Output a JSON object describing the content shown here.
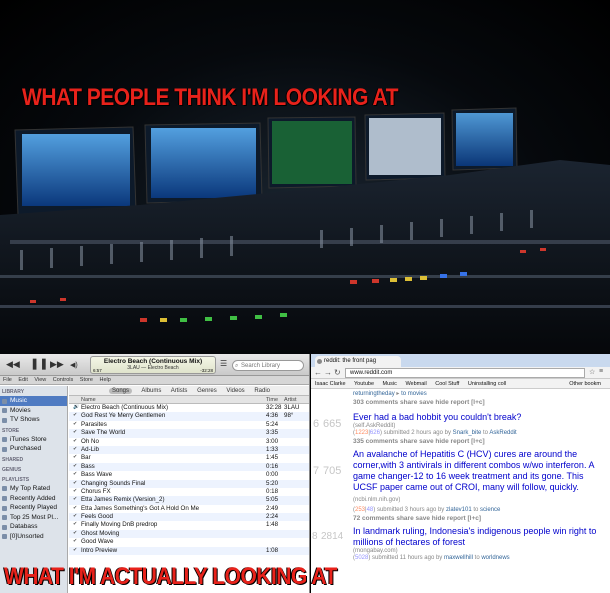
{
  "captions": {
    "top": "WHAT PEOPLE THINK I'M LOOKING AT",
    "bottom": "WHAT I'M ACTUALLY LOOKING AT"
  },
  "itunes": {
    "now_playing_title": "Electro Beach (Continuous Mix)",
    "now_playing_sub": "3LAU — Electro Beach",
    "elapsed": "6:57",
    "remaining": "-32:28",
    "search_placeholder": "Search Library",
    "menu": [
      "File",
      "Edit",
      "View",
      "Controls",
      "Store",
      "Help"
    ],
    "tabs": [
      "Songs",
      "Albums",
      "Artists",
      "Genres",
      "Videos",
      "Radio"
    ],
    "columns": {
      "name": "Name",
      "time": "Time",
      "artist": "Artist"
    },
    "sidebar": {
      "library_header": "LIBRARY",
      "library": [
        "Music",
        "Movies",
        "TV Shows"
      ],
      "store_header": "STORE",
      "store": [
        "iTunes Store",
        "Purchased"
      ],
      "shared_header": "SHARED",
      "genius_header": "GENIUS",
      "playlists_header": "PLAYLISTS",
      "playlists": [
        "My Top Rated",
        "Recently Added",
        "Recently Played",
        "Top 25 Most Pl...",
        "Databass",
        "[0]Unsorted"
      ]
    },
    "tracks": [
      {
        "name": "Electro Beach (Continuous Mix)",
        "time": "32:28",
        "artist": "3LAU"
      },
      {
        "name": "God Rest Ye Merry Gentlemen",
        "time": "4:36",
        "artist": "98°"
      },
      {
        "name": "Parasites",
        "time": "5:24",
        "artist": ""
      },
      {
        "name": "Save The World",
        "time": "3:35",
        "artist": ""
      },
      {
        "name": "Oh No",
        "time": "3:00",
        "artist": ""
      },
      {
        "name": "Ad-Lib",
        "time": "1:33",
        "artist": ""
      },
      {
        "name": "Bar",
        "time": "1:45",
        "artist": ""
      },
      {
        "name": "Bass",
        "time": "0:16",
        "artist": ""
      },
      {
        "name": "Bass Wave",
        "time": "0:00",
        "artist": ""
      },
      {
        "name": "Changing Sounds Final",
        "time": "5:20",
        "artist": ""
      },
      {
        "name": "Chorus FX",
        "time": "0:18",
        "artist": ""
      },
      {
        "name": "Etta James Remix (Version_2)",
        "time": "5:05",
        "artist": ""
      },
      {
        "name": "Etta James Something's Got A Hold On Me",
        "time": "2:49",
        "artist": ""
      },
      {
        "name": "Feels Good",
        "time": "2:24",
        "artist": ""
      },
      {
        "name": "Finally Moving DnB predrop",
        "time": "1:48",
        "artist": ""
      },
      {
        "name": "Ghost Moving",
        "time": "",
        "artist": ""
      },
      {
        "name": "Good Wave",
        "time": "",
        "artist": ""
      },
      {
        "name": "Intro Preview",
        "time": "1:08",
        "artist": ""
      }
    ]
  },
  "browser": {
    "tab_title": "reddit: the front pag",
    "url": "www.reddit.com",
    "bookmarks": [
      "Isaac Clarke",
      "Youtube",
      "Music",
      "Webmail",
      "Cool Stuff",
      "Uninstalling coll",
      "Other bookm"
    ],
    "top_partial": {
      "meta": "returningtheday",
      "to": "to movies",
      "comments": "303 comments share save hide report [l+c]"
    },
    "posts": [
      {
        "rank": "6",
        "score": "665",
        "title": "Ever had a bad hobbit you couldn't break?",
        "domain": "(self.AskReddit)",
        "up": "1223",
        "down": "626",
        "age": "submitted 2 hours ago by",
        "author": "Snark_bite",
        "sub": "AskReddit",
        "comments": "335 comments share save hide report [l+c]"
      },
      {
        "rank": "7",
        "score": "705",
        "title": "An avalanche of Hepatitis C (HCV) cures are around the corner,with 3 antivirals in different combos w/wo interferon. A game changer-12 to 16 week treatment and its gone. This UCSF paper came out of CROI, many will follow, quickly.",
        "domain": "(ncbi.nlm.nih.gov)",
        "up": "253",
        "down": "48",
        "age": "submitted 3 hours ago by",
        "author": "zlatev101",
        "sub": "science",
        "comments": "72 comments share save hide report [l+c]"
      },
      {
        "rank": "8",
        "score": "2814",
        "title": "In landmark ruling, Indonesia's indigenous people win right to millions of hectares of forest",
        "domain": "(mongabay.com)",
        "up": "",
        "down": "5028",
        "age": "submitted 11 hours ago by",
        "author": "maxwellhill",
        "sub": "worldnews",
        "comments": ""
      }
    ]
  }
}
